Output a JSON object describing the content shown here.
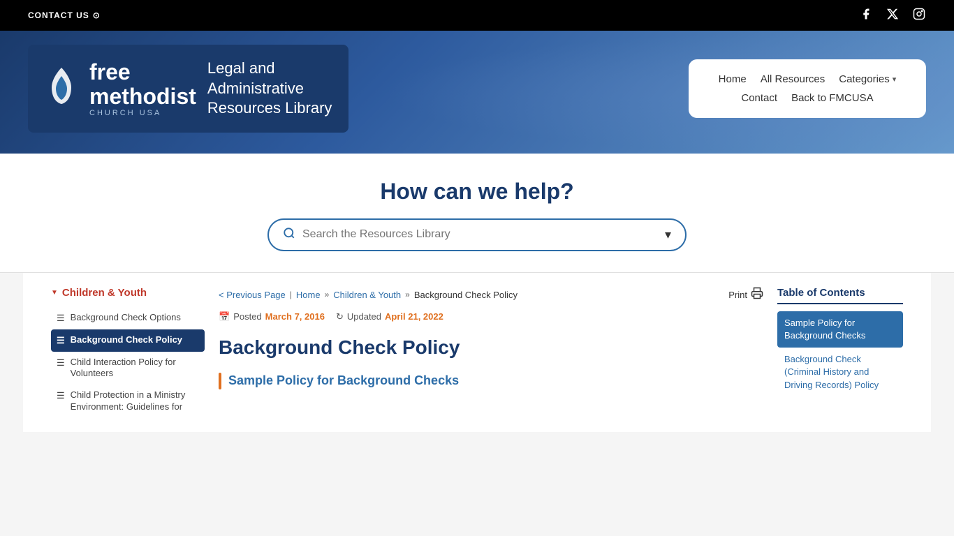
{
  "topbar": {
    "contact_label": "CONTACT US",
    "contact_icon": "⊙",
    "social": [
      {
        "name": "facebook",
        "icon": "f"
      },
      {
        "name": "twitter-x",
        "icon": "𝕏"
      },
      {
        "name": "instagram",
        "icon": "◻"
      }
    ]
  },
  "header": {
    "logo_brand_line1": "free",
    "logo_brand_line2": "methodist",
    "logo_church": "CHURCH USA",
    "logo_title_line1": "Legal and",
    "logo_title_line2": "Administrative",
    "logo_title_line3": "Resources Library",
    "nav": [
      {
        "label": "Home",
        "id": "home"
      },
      {
        "label": "All Resources",
        "id": "all-resources"
      },
      {
        "label": "Categories",
        "id": "categories",
        "has_dropdown": true
      },
      {
        "label": "Contact",
        "id": "contact"
      },
      {
        "label": "Back to FMCUSA",
        "id": "back-fmcusa"
      }
    ]
  },
  "search": {
    "heading": "How can we help?",
    "placeholder": "Search the Resources Library"
  },
  "breadcrumb": {
    "previous_page": "< Previous Page",
    "home": "Home",
    "category": "Children & Youth",
    "current": "Background Check Policy",
    "print": "Print"
  },
  "meta": {
    "posted_label": "Posted",
    "posted_date": "March 7, 2016",
    "updated_label": "Updated",
    "updated_date": "April 21, 2022"
  },
  "article": {
    "title": "Background Check Policy",
    "first_section": "Sample Policy for Background Checks"
  },
  "sidebar": {
    "category_title": "Children & Youth",
    "items": [
      {
        "label": "Background Check Options",
        "active": false
      },
      {
        "label": "Background Check Policy",
        "active": true
      },
      {
        "label": "Child Interaction Policy for Volunteers",
        "active": false
      },
      {
        "label": "Child Protection in a Ministry Environment: Guidelines for",
        "active": false
      }
    ]
  },
  "toc": {
    "heading": "Table of Contents",
    "items": [
      {
        "label": "Sample Policy for Background Checks",
        "active": true
      },
      {
        "label": "Background Check (Criminal History and Driving Records) Policy",
        "active": false
      }
    ]
  }
}
